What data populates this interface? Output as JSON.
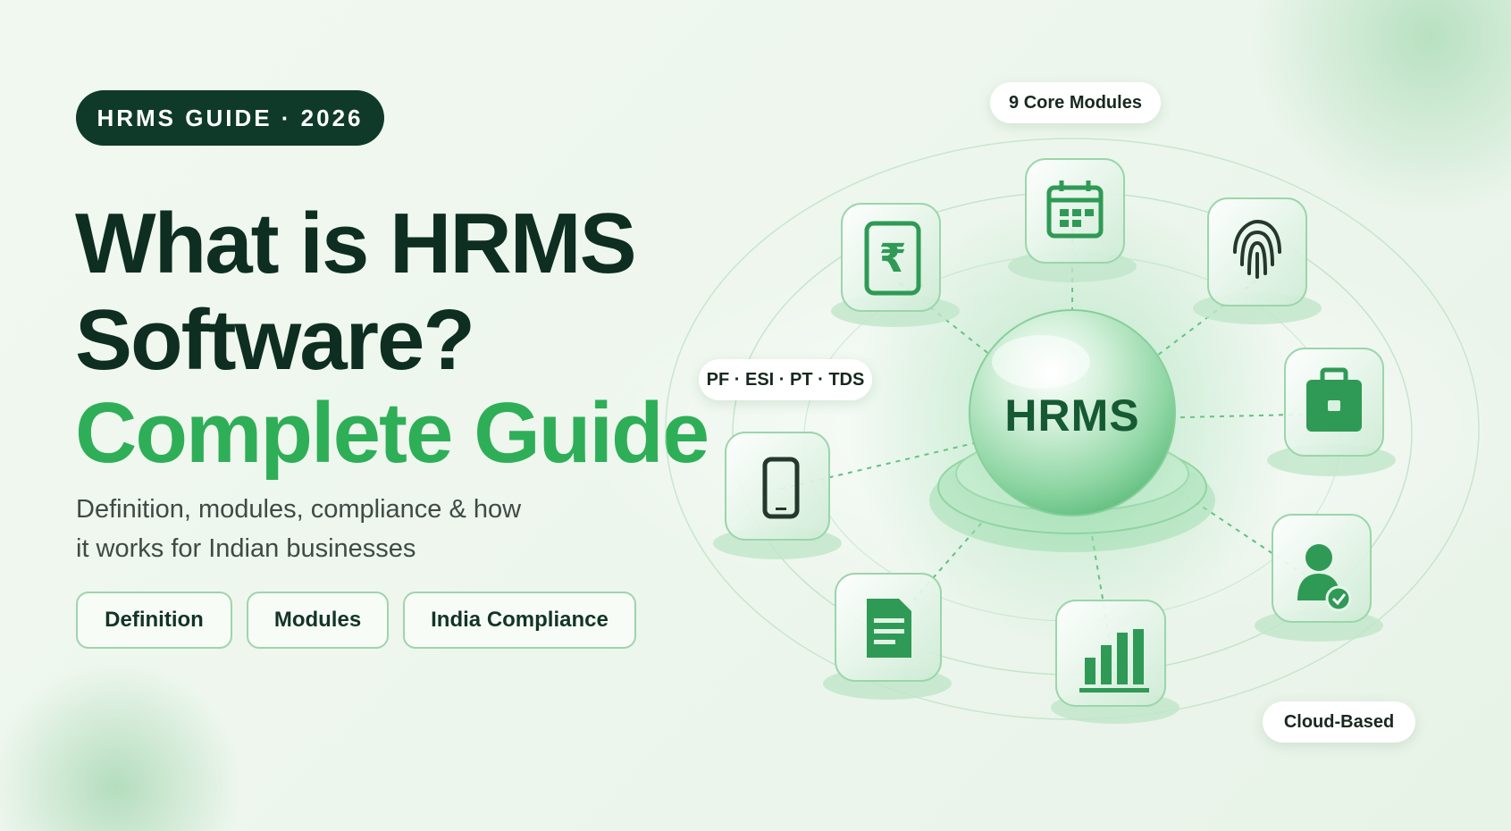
{
  "badge": "HRMS GUIDE · 2026",
  "headline": {
    "line1": "What is HRMS",
    "line2": "Software?",
    "line3": "Complete Guide"
  },
  "subtitle": {
    "line1": "Definition, modules, compliance & how",
    "line2": "it works for Indian businesses"
  },
  "chips": [
    "Definition",
    "Modules",
    "India Compliance"
  ],
  "callouts": {
    "core_modules": "9 Core Modules",
    "taxes": "PF · ESI · PT · TDS",
    "cloud": "Cloud-Based"
  },
  "hub": "HRMS",
  "module_icons": [
    "rupee-payroll-icon",
    "calendar-icon",
    "fingerprint-icon",
    "briefcase-icon",
    "user-verified-icon",
    "bar-chart-icon",
    "document-icon",
    "mobile-phone-icon"
  ],
  "colors": {
    "brand_dark": "#0f3a29",
    "brand_green": "#2fae58",
    "icon_green": "#2f9a55"
  }
}
